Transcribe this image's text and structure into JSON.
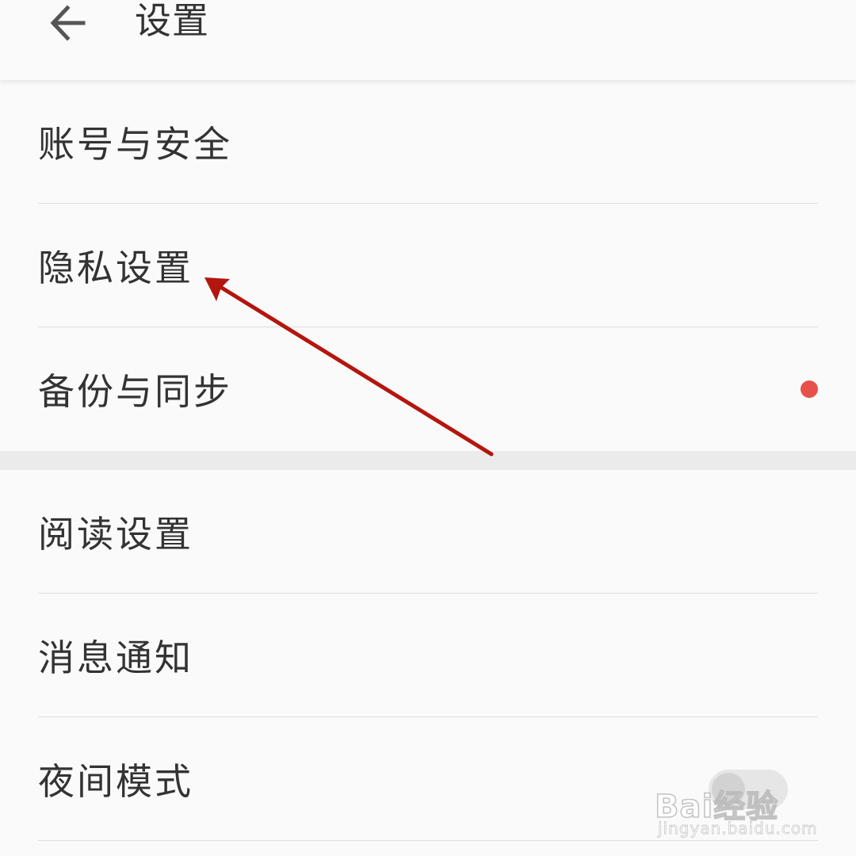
{
  "header": {
    "title": "设置",
    "back_icon": "arrow-left-icon"
  },
  "settings_group_1": [
    {
      "label": "账号与安全"
    },
    {
      "label": "隐私设置"
    },
    {
      "label": "备份与同步",
      "badge_color": "#e8514b"
    }
  ],
  "settings_group_2": [
    {
      "label": "阅读设置"
    },
    {
      "label": "消息通知"
    },
    {
      "label": "夜间模式",
      "toggle": "off"
    }
  ],
  "annotation": {
    "type": "arrow",
    "color": "#b3160e",
    "points_to": "隐私设置"
  },
  "watermark": {
    "brand": "Bai经验",
    "url": "jingyan.baidu.com"
  },
  "colors": {
    "background": "#fafafa",
    "divider": "#dedede",
    "group_gap": "#ebebeb",
    "text": "#333333"
  }
}
